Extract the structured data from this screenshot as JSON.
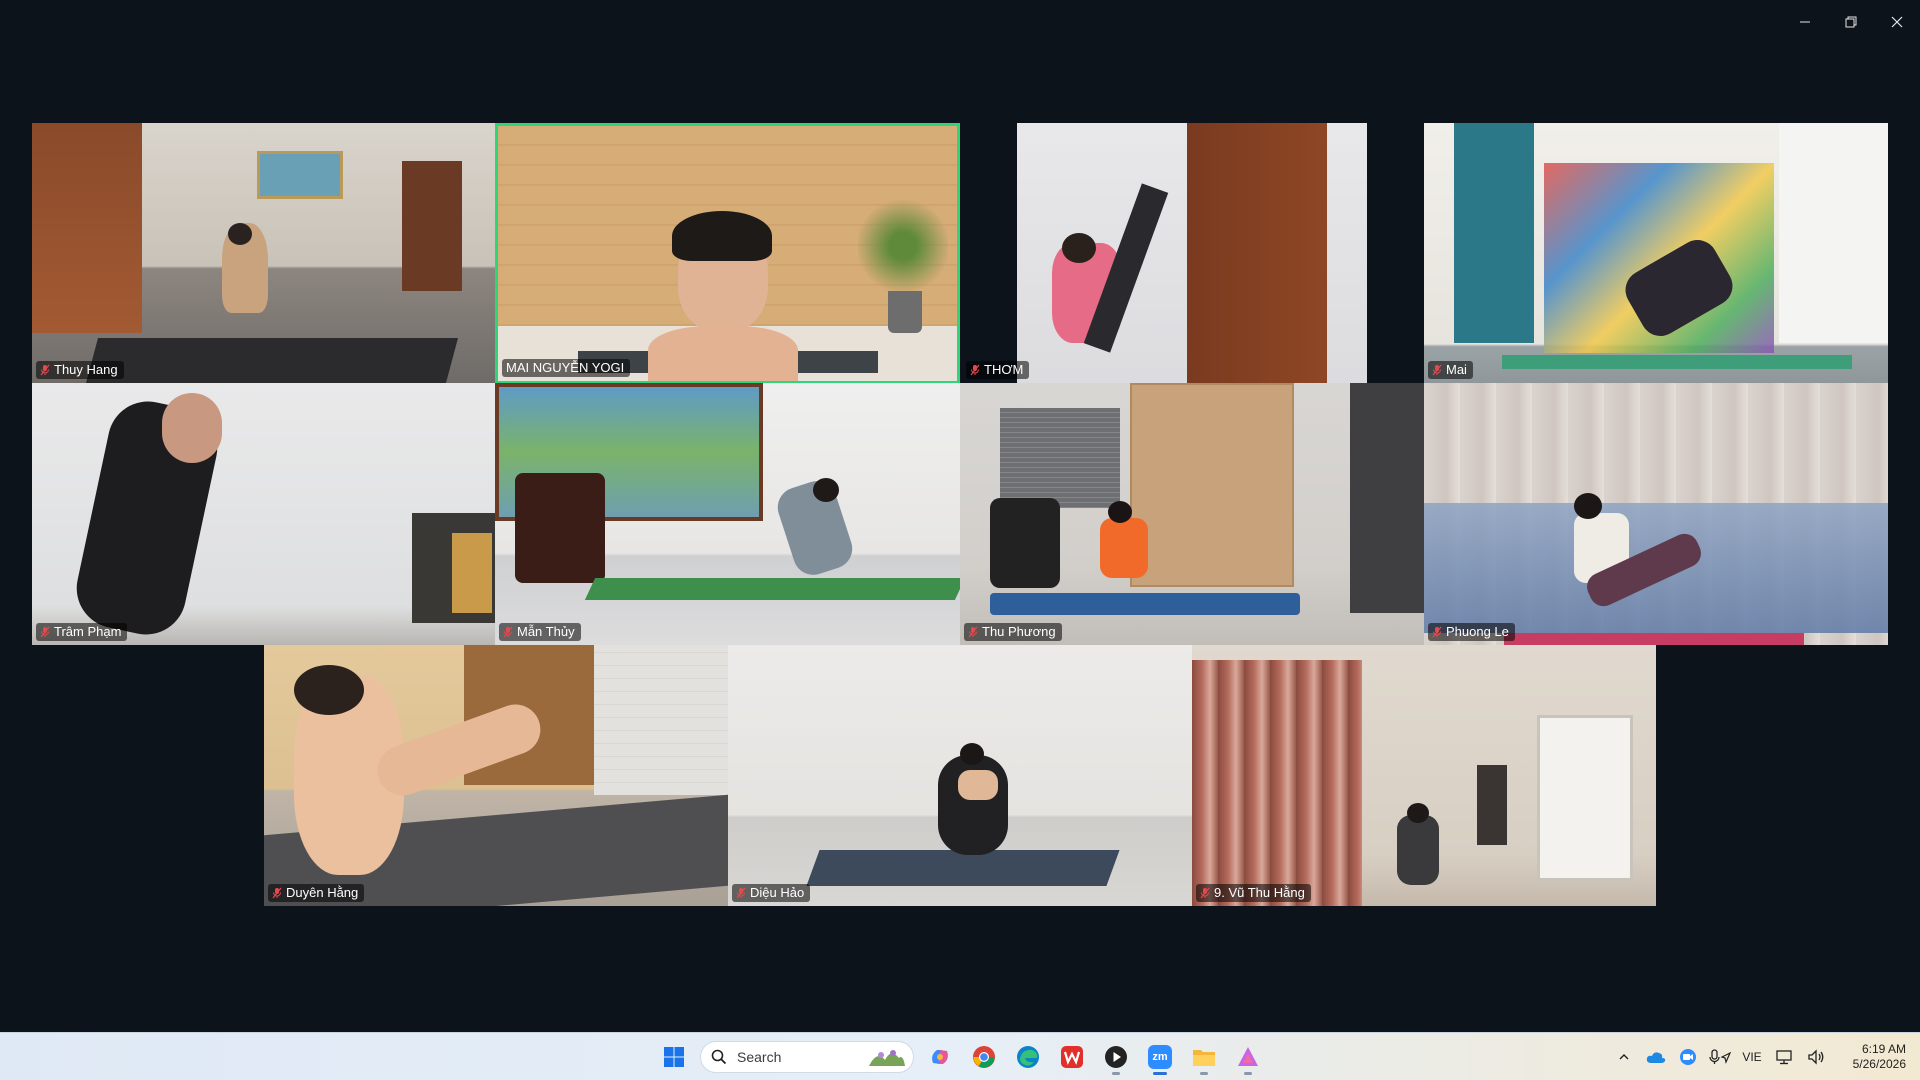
{
  "window": {
    "controls": [
      "minimize-icon",
      "restore-icon",
      "close-icon"
    ]
  },
  "participants": [
    {
      "name": "Thuy Hang",
      "muted": true,
      "active": false
    },
    {
      "name": "MAI NGUYỄN YOGI",
      "muted": false,
      "active": true
    },
    {
      "name": "THƠM",
      "muted": true,
      "active": false
    },
    {
      "name": "Mai",
      "muted": true,
      "active": false
    },
    {
      "name": "Trâm Phạm",
      "muted": true,
      "active": false
    },
    {
      "name": "Mẫn Thủy",
      "muted": true,
      "active": false
    },
    {
      "name": "Thu Phương",
      "muted": true,
      "active": false
    },
    {
      "name": "Phuong Le",
      "muted": true,
      "active": false
    },
    {
      "name": "Duyên Hằng",
      "muted": true,
      "active": false
    },
    {
      "name": "Diệu Hảo",
      "muted": true,
      "active": false
    },
    {
      "name": "9. Vũ Thu Hằng",
      "muted": true,
      "active": false
    }
  ],
  "colors": {
    "background": "#0d131b",
    "active_speaker_border": "#2fd57a",
    "muted_icon": "#e5484d"
  },
  "taskbar": {
    "search_placeholder": "Search",
    "apps": [
      "windows-start-icon",
      "copilot-icon",
      "chrome-icon",
      "edge-icon",
      "wps-office-icon",
      "media-player-icon",
      "zoom-icon",
      "file-explorer-icon",
      "arc-app-icon"
    ],
    "zoom_label": "zm",
    "tray": {
      "language": "VIE",
      "time": "6:19 AM",
      "date": "5/26/2026"
    }
  }
}
